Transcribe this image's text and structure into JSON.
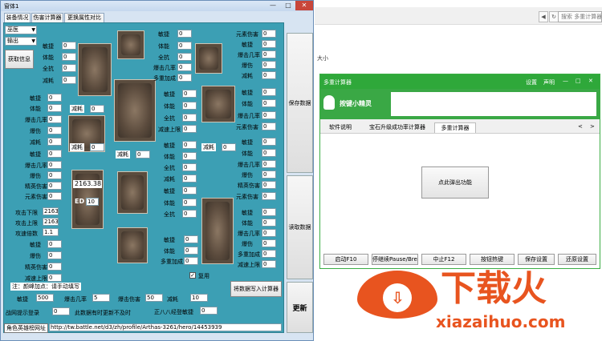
{
  "explorer": {
    "search_placeholder": "搜索 多重计算器",
    "side_text": "大小",
    "nav_back": "◀",
    "nav_refresh": "↻"
  },
  "main_window": {
    "title": "窗体1",
    "min": "—",
    "max": "□",
    "close": "✕",
    "tabs": [
      "装备情况",
      "伤害计算器",
      "更换属性对比"
    ],
    "class_select": "巫医",
    "source_select": "输出",
    "get_info_button": "获取信息",
    "save_button": "保存数据",
    "read_button": "读取数据",
    "update_button": "更新",
    "write_button": "将数据写入计算器",
    "ring_value": "2163.38",
    "ed_label": "ED",
    "ed_value": "10",
    "checkbox_label": "复用",
    "attack_min_label": "攻击下限",
    "attack_min_value": "2163",
    "attack_max_label": "攻击上限",
    "attack_max_value": "2163",
    "attack_speed_label": "攻速倍数",
    "attack_speed_value": "1.1",
    "note_label": "注：颜峰加点：请手动填写",
    "bottom_labels": {
      "agility": "敏捷",
      "agility_value": "500",
      "crit_rate": "爆击几率",
      "crit_rate_value": "5",
      "crit_dmg": "爆击伤害",
      "crit_dmg_value": "50",
      "reduce": "减耗",
      "reduce_value": "10"
    },
    "row2": {
      "label1": "战网提示登录",
      "value1": "0",
      "label2": "此数据有时更新不及时",
      "label3": "正八八经登敏捷",
      "value3": "0"
    },
    "url_label": "角色英雄榜网址",
    "url_value": "http://tw.battle.net/d3/zh/profile/Arthas-3261/hero/14453939",
    "stat_labels": {
      "agi": "敏捷",
      "vit": "体能",
      "res": "全抗",
      "reduce": "减耗",
      "crit": "爆击几率",
      "injury": "爆伤",
      "elem": "元素伤害",
      "multi": "多重加成",
      "elite": "精英伤害",
      "frame": "减速上限",
      "all_res": "全抗",
      "max_hp": "敏捷"
    },
    "mini_labels": [
      "减耗",
      "减耗",
      "减耗",
      "减耗"
    ],
    "mini_values": [
      "0",
      "0",
      "0",
      "0"
    ]
  },
  "calc_window": {
    "title": "多重计算器",
    "settings": "设置",
    "help": "声明",
    "min": "—",
    "max": "□",
    "close": "✕",
    "logo_text": "按键小精灵",
    "tabs": [
      "软件说明",
      "宝石升级成功率计算器",
      "多重计算器"
    ],
    "nav_prev": "<",
    "nav_next": ">",
    "center_button": "点此弹出功能",
    "bottom_buttons": [
      "启动F10",
      "停继续Pause/Break",
      "中止F12",
      "按钮热键",
      "保存设置",
      "还原设置"
    ]
  },
  "watermark": {
    "brand": "下载火",
    "domain": "xiazaihuo.com",
    "color": "#e8541f"
  }
}
